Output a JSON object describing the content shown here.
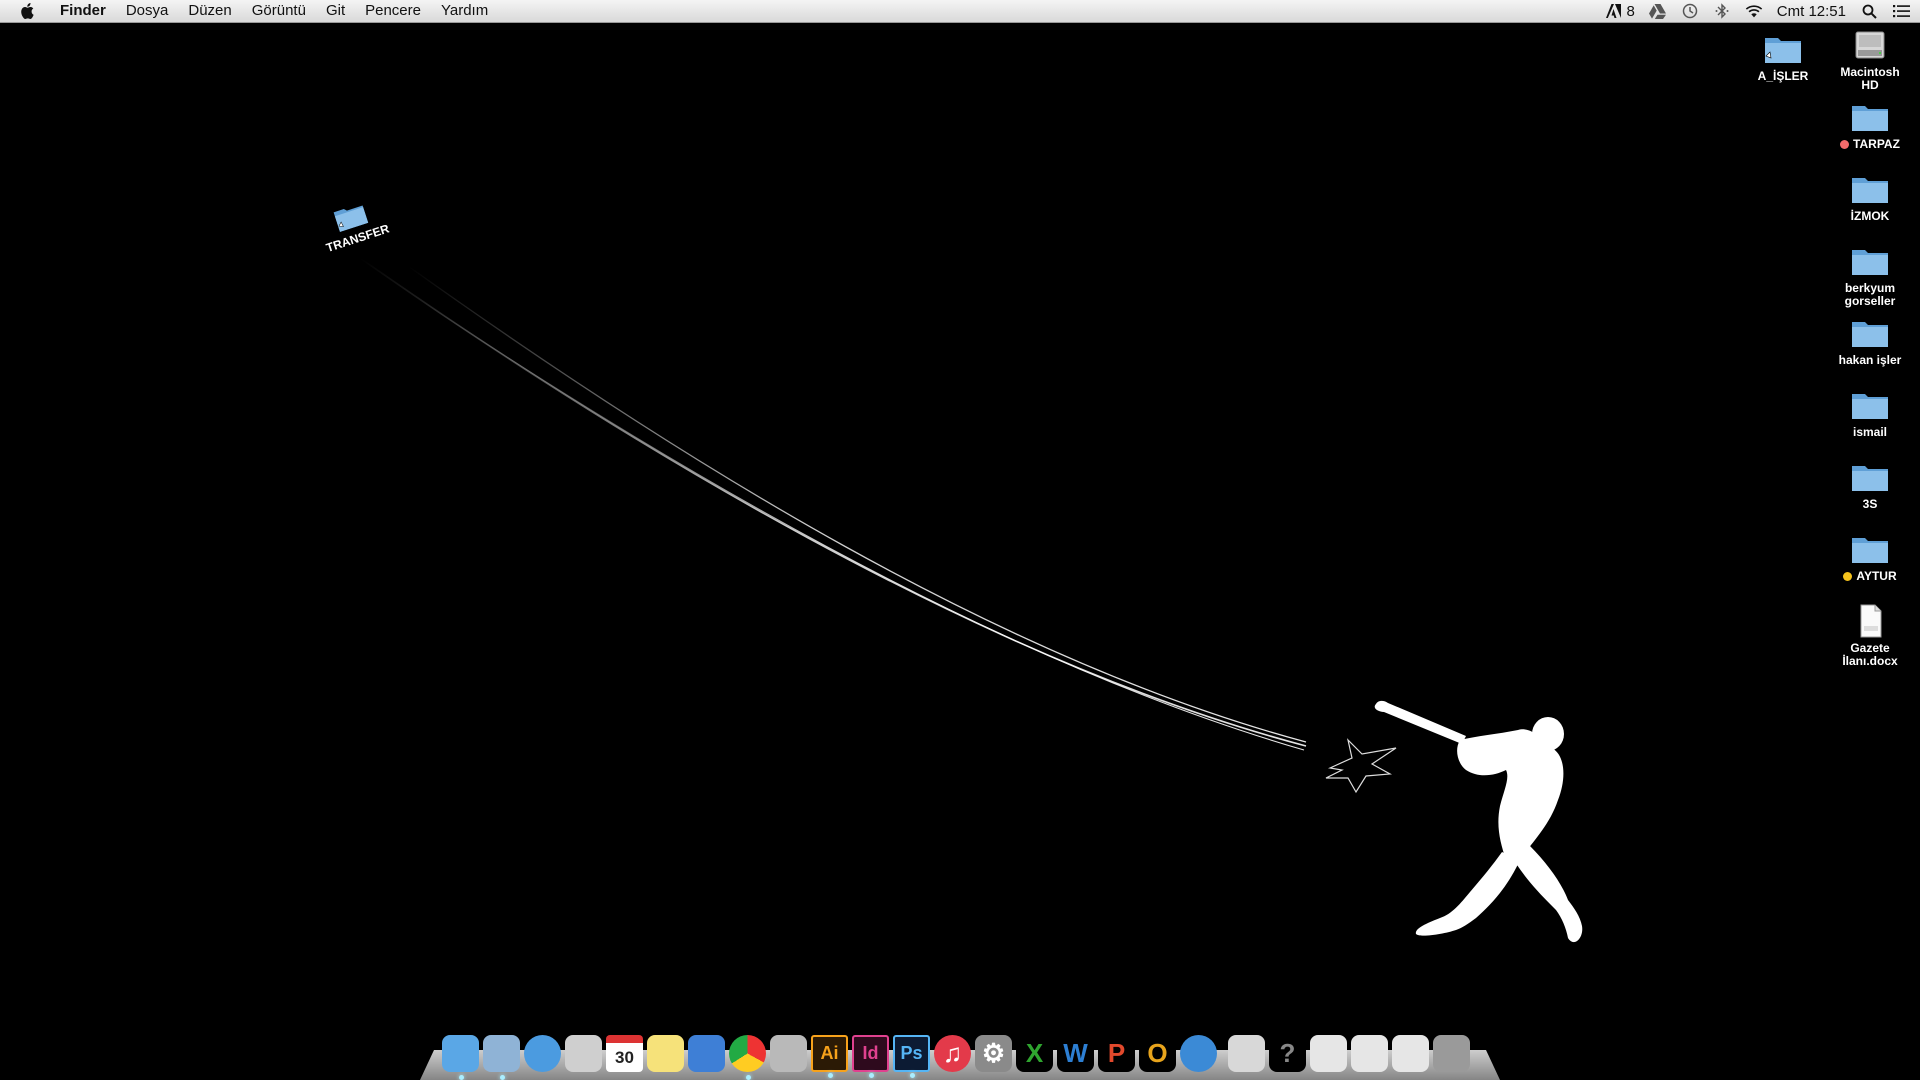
{
  "menubar": {
    "app_name": "Finder",
    "menus": [
      "Dosya",
      "Düzen",
      "Görüntü",
      "Git",
      "Pencere",
      "Yardım"
    ],
    "status": {
      "adobe_count": "8",
      "clock": "Cmt 12:51"
    }
  },
  "desktop_icons": [
    {
      "label": "A_İŞLER",
      "kind": "folder",
      "tag": ""
    },
    {
      "label": "Macintosh\nHD",
      "kind": "drive",
      "tag": ""
    },
    {
      "label": "TARPAZ",
      "kind": "folder",
      "tag": "#f36b6b"
    },
    {
      "label": "İZMOK",
      "kind": "folder",
      "tag": ""
    },
    {
      "label": "berkyum\ngorseller",
      "kind": "folder",
      "tag": ""
    },
    {
      "label": "hakan işler",
      "kind": "folder",
      "tag": ""
    },
    {
      "label": "ismail",
      "kind": "folder",
      "tag": ""
    },
    {
      "label": "3S",
      "kind": "folder",
      "tag": ""
    },
    {
      "label": "AYTUR",
      "kind": "folder",
      "tag": "#f5c31c"
    },
    {
      "label": "Gazete\nİlanı.docx",
      "kind": "document",
      "tag": ""
    }
  ],
  "transfer_folder": {
    "label": "TRANSFER"
  },
  "dock": {
    "apps": [
      {
        "name": "finder-icon",
        "glyph": "",
        "bg": "#5aa7e6",
        "running": true
      },
      {
        "name": "mail-icon",
        "glyph": "",
        "bg": "#8fb3d6",
        "running": true
      },
      {
        "name": "safari-icon",
        "glyph": "",
        "bg": "#4b9be0",
        "running": false
      },
      {
        "name": "calculator-icon",
        "glyph": "",
        "bg": "#cfcfcf",
        "running": false
      },
      {
        "name": "calendar-icon",
        "glyph": "30",
        "bg": "#ffffff",
        "running": false
      },
      {
        "name": "notes-icon",
        "glyph": "",
        "bg": "#f6e27a",
        "running": false
      },
      {
        "name": "keynote-icon",
        "glyph": "",
        "bg": "#3e7fd6",
        "running": false
      },
      {
        "name": "chrome-icon",
        "glyph": "",
        "bg": "#ffffff",
        "running": true
      },
      {
        "name": "preview-icon",
        "glyph": "",
        "bg": "#b9b9b9",
        "running": false
      },
      {
        "name": "illustrator-icon",
        "glyph": "Ai",
        "bg": "#2b1a05",
        "running": true
      },
      {
        "name": "indesign-icon",
        "glyph": "Id",
        "bg": "#2e0a1d",
        "running": true
      },
      {
        "name": "photoshop-icon",
        "glyph": "Ps",
        "bg": "#0c1b33",
        "running": true
      },
      {
        "name": "itunes-icon",
        "glyph": "♫",
        "bg": "#e33a4a",
        "running": false
      },
      {
        "name": "system-preferences-icon",
        "glyph": "⚙",
        "bg": "#8a8a8a",
        "running": false
      },
      {
        "name": "excel-icon",
        "glyph": "X",
        "bg": "#000000",
        "running": false
      },
      {
        "name": "word-icon",
        "glyph": "W",
        "bg": "#000000",
        "running": false
      },
      {
        "name": "powerpoint-icon",
        "glyph": "P",
        "bg": "#000000",
        "running": false
      },
      {
        "name": "outlook-icon",
        "glyph": "O",
        "bg": "#000000",
        "running": false
      },
      {
        "name": "network-globe-icon",
        "glyph": "",
        "bg": "#3b8ad6",
        "running": false
      }
    ],
    "stacks": [
      {
        "name": "documents-stack-icon",
        "glyph": "",
        "bg": "#d8d8d8"
      },
      {
        "name": "help-icon",
        "glyph": "?",
        "bg": "#000000"
      },
      {
        "name": "downloads-stack-1-icon",
        "glyph": "",
        "bg": "#e6e6e6"
      },
      {
        "name": "downloads-stack-2-icon",
        "glyph": "",
        "bg": "#e6e6e6"
      },
      {
        "name": "downloads-stack-3-icon",
        "glyph": "",
        "bg": "#e6e6e6"
      },
      {
        "name": "trash-icon",
        "glyph": "",
        "bg": "#9a9a9a"
      }
    ]
  },
  "colors": {
    "folder": "#8cc0ea",
    "folder_dark": "#5f9fd6",
    "excel": "#2fa52f",
    "word": "#2d7fd3",
    "powerpoint": "#e2492c",
    "outlook": "#e8a41c",
    "illustrator_text": "#f7a21b",
    "indesign_text": "#e0418f",
    "photoshop_text": "#55b5f5"
  }
}
